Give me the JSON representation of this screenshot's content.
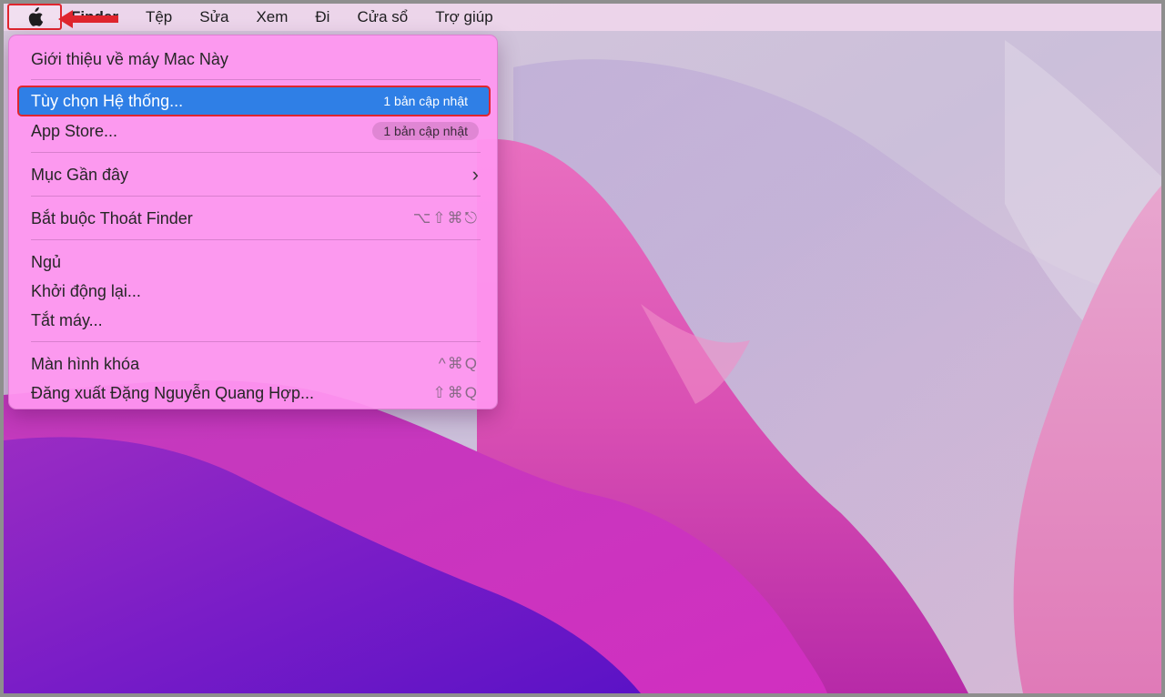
{
  "menubar": {
    "apple_icon": "apple-logo-icon",
    "items": [
      {
        "label": "Finder"
      },
      {
        "label": "Tệp"
      },
      {
        "label": "Sửa"
      },
      {
        "label": "Xem"
      },
      {
        "label": "Đi"
      },
      {
        "label": "Cửa sổ"
      },
      {
        "label": "Trợ giúp"
      }
    ]
  },
  "apple_menu": {
    "about": "Giới thiệu về máy Mac Này",
    "system_prefs": "Tùy chọn Hệ thống...",
    "system_prefs_badge": "1 bản cập nhật",
    "app_store": "App Store...",
    "app_store_badge": "1 bản cập nhật",
    "recent_items": "Mục Gần đây",
    "recent_items_chevron": "›",
    "force_quit": "Bắt buộc Thoát Finder",
    "force_quit_shortcut": "⌥⇧⌘⎋",
    "sleep": "Ngủ",
    "restart": "Khởi động lại...",
    "shutdown": "Tắt máy...",
    "lock_screen": "Màn hình khóa",
    "lock_screen_shortcut": "^⌘Q",
    "logout": "Đăng xuất Đặng Nguyễn Quang Hợp...",
    "logout_shortcut": "⇧⌘Q"
  },
  "colors": {
    "highlight": "#2f7fe6",
    "annotation": "#e0252e"
  }
}
